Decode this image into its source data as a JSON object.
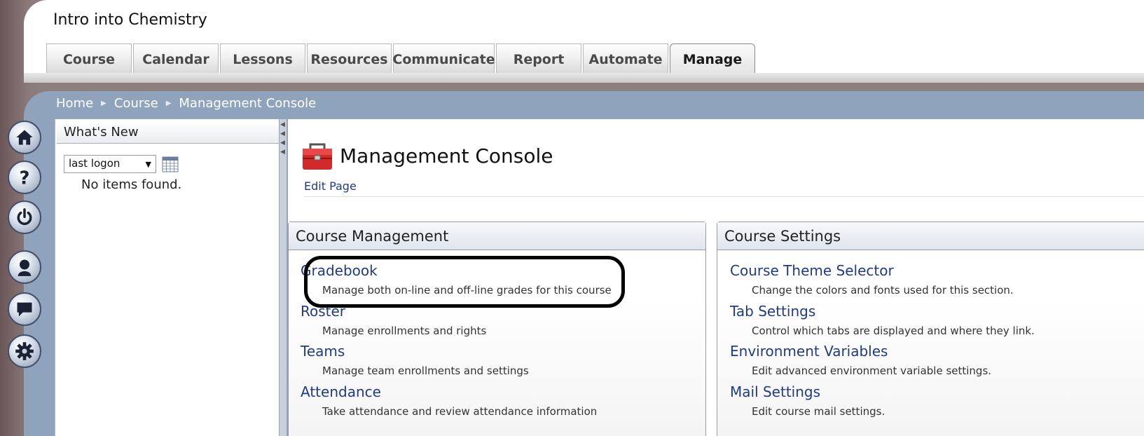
{
  "header": {
    "course_title": "Intro into Chemistry",
    "tabs": [
      {
        "label": "Course"
      },
      {
        "label": "Calendar"
      },
      {
        "label": "Lessons"
      },
      {
        "label": "Resources"
      },
      {
        "label": "Communicate"
      },
      {
        "label": "Report"
      },
      {
        "label": "Automate"
      },
      {
        "label": "Manage",
        "active": true
      }
    ]
  },
  "breadcrumb": [
    "Home",
    "Course",
    "Management Console"
  ],
  "side_icons": [
    "home-icon",
    "help-icon",
    "power-icon",
    "user-icon",
    "chat-icon",
    "gear-icon"
  ],
  "whats_new": {
    "title": "What's New",
    "filter_value": "last logon",
    "empty_text": "No items found."
  },
  "main": {
    "title": "Management Console",
    "edit_link": "Edit Page",
    "course_management": {
      "title": "Course Management",
      "items": [
        {
          "label": "Gradebook",
          "description": "Manage both on-line and off-line grades for this course"
        },
        {
          "label": "Roster",
          "description": "Manage enrollments and rights"
        },
        {
          "label": "Teams",
          "description": "Manage team enrollments and settings"
        },
        {
          "label": "Attendance",
          "description": "Take attendance and review attendance information"
        }
      ]
    },
    "course_settings": {
      "title": "Course Settings",
      "items": [
        {
          "label": "Course Theme Selector",
          "description": "Change the colors and fonts used for this section."
        },
        {
          "label": "Tab Settings",
          "description": "Control which tabs are displayed and where they link."
        },
        {
          "label": "Environment Variables",
          "description": "Edit advanced environment variable settings."
        },
        {
          "label": "Mail Settings",
          "description": "Edit course mail settings."
        }
      ]
    }
  },
  "colors": {
    "link": "#1f3a8a",
    "band": "#8fa3bd",
    "highlight_ring": "#000000"
  }
}
